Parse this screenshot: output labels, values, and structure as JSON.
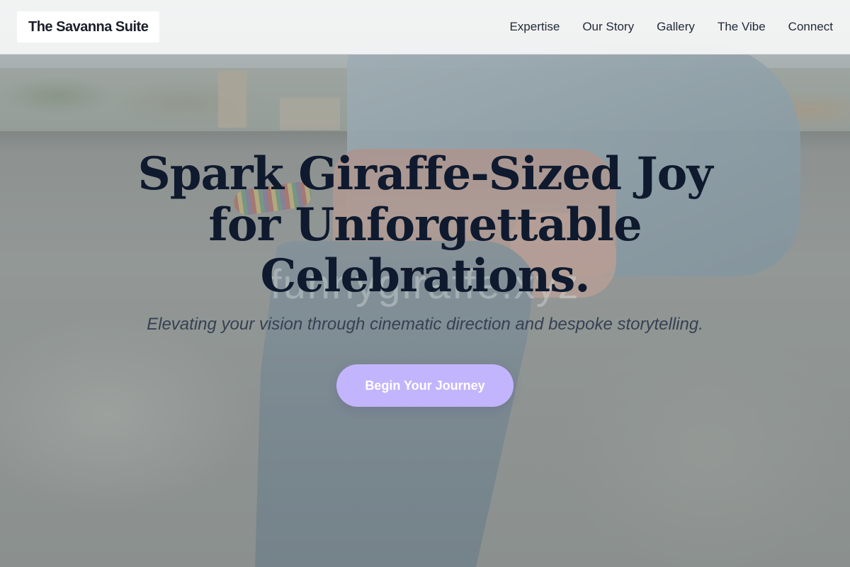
{
  "nav": {
    "brand": "The Savanna Suite",
    "links": [
      "Expertise",
      "Our Story",
      "Gallery",
      "The Vibe",
      "Connect"
    ]
  },
  "hero": {
    "headline": "Spark Giraffe-Sized Joy for Unforgettable Celebrations.",
    "subheadline": "Elevating your vision through cinematic direction and bespoke storytelling.",
    "cta_label": "Begin Your Journey",
    "watermark": "funnygiraffe.xyz"
  },
  "colors": {
    "cta_background": "#c3b5fd",
    "headline_text": "#0f1a2e",
    "nav_background": "#f5f6f6"
  }
}
